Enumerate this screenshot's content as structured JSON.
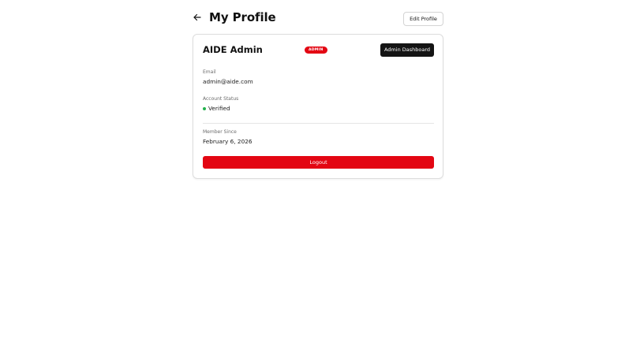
{
  "header": {
    "title": "My Profile",
    "back_icon": "arrow-left-icon",
    "edit_label": "Edit Profile"
  },
  "profile": {
    "name": "AIDE Admin",
    "role_badge": "ADMIN",
    "admin_dashboard_label": "Admin Dashboard",
    "email_label": "Email",
    "email": "admin@aide.com",
    "status_label": "Account Status",
    "status": "Verified",
    "status_color": "#22b14c",
    "member_since_label": "Member Since",
    "member_since": "February 6, 2026",
    "logout_label": "Logout"
  },
  "colors": {
    "accent": "#e30613",
    "dark_button": "#141414"
  }
}
